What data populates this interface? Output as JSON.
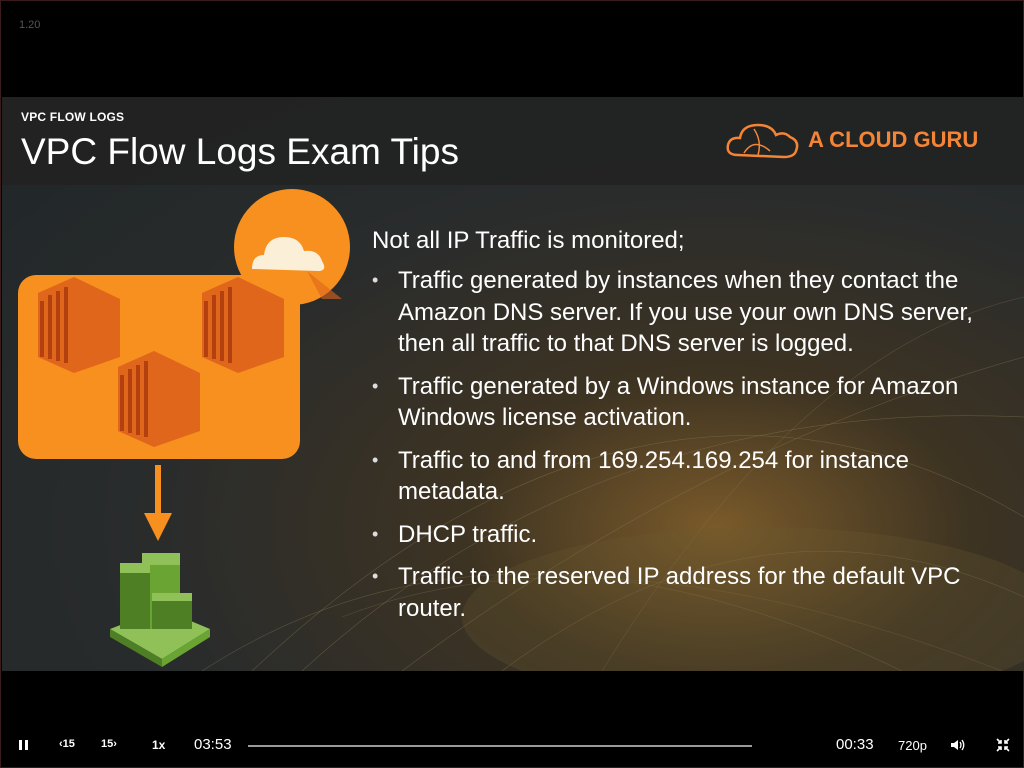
{
  "player": {
    "version": "1.20",
    "elapsed": "03:53",
    "remaining": "00:33",
    "quality": "720p",
    "speed": "1x",
    "rewind_label": "15",
    "forward_label": "15",
    "progress": 0.0,
    "icons": [
      "pause-icon",
      "rewind-15-icon",
      "forward-15-icon",
      "volume-icon",
      "exit-fullscreen-icon"
    ]
  },
  "slide": {
    "kicker": "VPC FLOW LOGS",
    "title": "VPC Flow Logs Exam Tips",
    "brand": "A CLOUD GURU",
    "lead": "Not all IP Traffic is monitored;",
    "bullets": [
      "Traffic generated by instances when they contact the Amazon DNS server. If you use your own DNS server, then all traffic to that DNS server is logged.",
      "Traffic generated by a Windows instance for Amazon Windows license activation.",
      "Traffic to and from 169.254.169.254 for instance metadata.",
      "DHCP traffic.",
      "Traffic to the reserved IP address for the default VPC router."
    ],
    "bullet_glyph": "•",
    "colors": {
      "orange": "#f7901e",
      "orange_dark": "#e0661b",
      "green": "#6aa533",
      "header_bg": "#222222",
      "brand": "#f58536"
    }
  }
}
